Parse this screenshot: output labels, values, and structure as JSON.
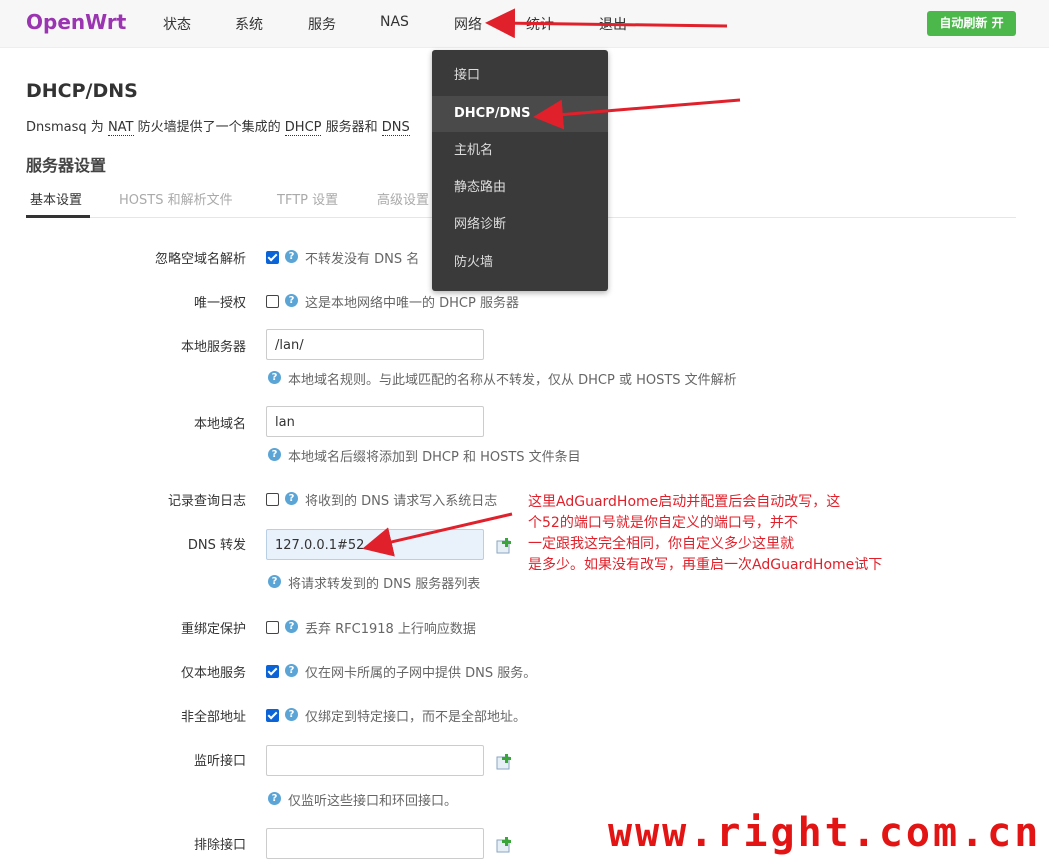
{
  "brand": "OpenWrt",
  "nav": {
    "items": [
      "状态",
      "系统",
      "服务",
      "NAS",
      "网络",
      "统计",
      "退出"
    ],
    "refresh": "自动刷新 开"
  },
  "dropdown": {
    "items": [
      "接口",
      "DHCP/DNS",
      "主机名",
      "静态路由",
      "网络诊断",
      "防火墙"
    ]
  },
  "page": {
    "title": "DHCP/DNS",
    "desc_prefix": "Dnsmasq 为 ",
    "desc_nat": "NAT",
    "desc_mid": " 防火墙提供了一个集成的 ",
    "desc_dhcp": "DHCP",
    "desc_mid2": " 服务器和 ",
    "desc_dns": "DNS",
    "section": "服务器设置"
  },
  "tabs": [
    "基本设置",
    "HOSTS 和解析文件",
    "TFTP 设置",
    "高级设置"
  ],
  "form": {
    "domain_needed": {
      "label": "忽略空域名解析",
      "desc": "不转发没有 DNS 名"
    },
    "authoritative": {
      "label": "唯一授权",
      "desc": "这是本地网络中唯一的 DHCP 服务器"
    },
    "local_server": {
      "label": "本地服务器",
      "value": "/lan/",
      "desc": "本地域名规则。与此域匹配的名称从不转发，仅从 DHCP 或 HOSTS 文件解析"
    },
    "local_domain": {
      "label": "本地域名",
      "value": "lan",
      "desc": "本地域名后缀将添加到 DHCP 和 HOSTS 文件条目"
    },
    "log_queries": {
      "label": "记录查询日志",
      "desc": "将收到的 DNS 请求写入系统日志"
    },
    "dns_forward": {
      "label": "DNS 转发",
      "value": "127.0.0.1#52",
      "desc": "将请求转发到的 DNS 服务器列表"
    },
    "rebind_protection": {
      "label": "重绑定保护",
      "desc": "丢弃 RFC1918 上行响应数据"
    },
    "local_service": {
      "label": "仅本地服务",
      "desc": "仅在网卡所属的子网中提供 DNS 服务。"
    },
    "nonwildcard": {
      "label": "非全部地址",
      "desc": "仅绑定到特定接口，而不是全部地址。"
    },
    "listen_interface": {
      "label": "监听接口",
      "value": "",
      "desc": "仅监听这些接口和环回接口。"
    },
    "exclude_interface": {
      "label": "排除接口",
      "value": ""
    }
  },
  "annotation": {
    "line1": "这里AdGuardHome启动并配置后会自动改写，这",
    "line2": "个52的端口号就是你自定义的端口号，并不",
    "line3": "一定跟我这完全相同，你自定义多少这里就",
    "line4": "是多少。如果没有改写，再重启一次AdGuardHome试下"
  },
  "watermark": "www.right.com.cn",
  "colors": {
    "brand": "#9b34b1",
    "refresh_button": "#4cb84c",
    "dropdown_bg": "#3a3a3a",
    "annotation": "#e0202a",
    "checkbox_checked": "#0a64d8"
  }
}
